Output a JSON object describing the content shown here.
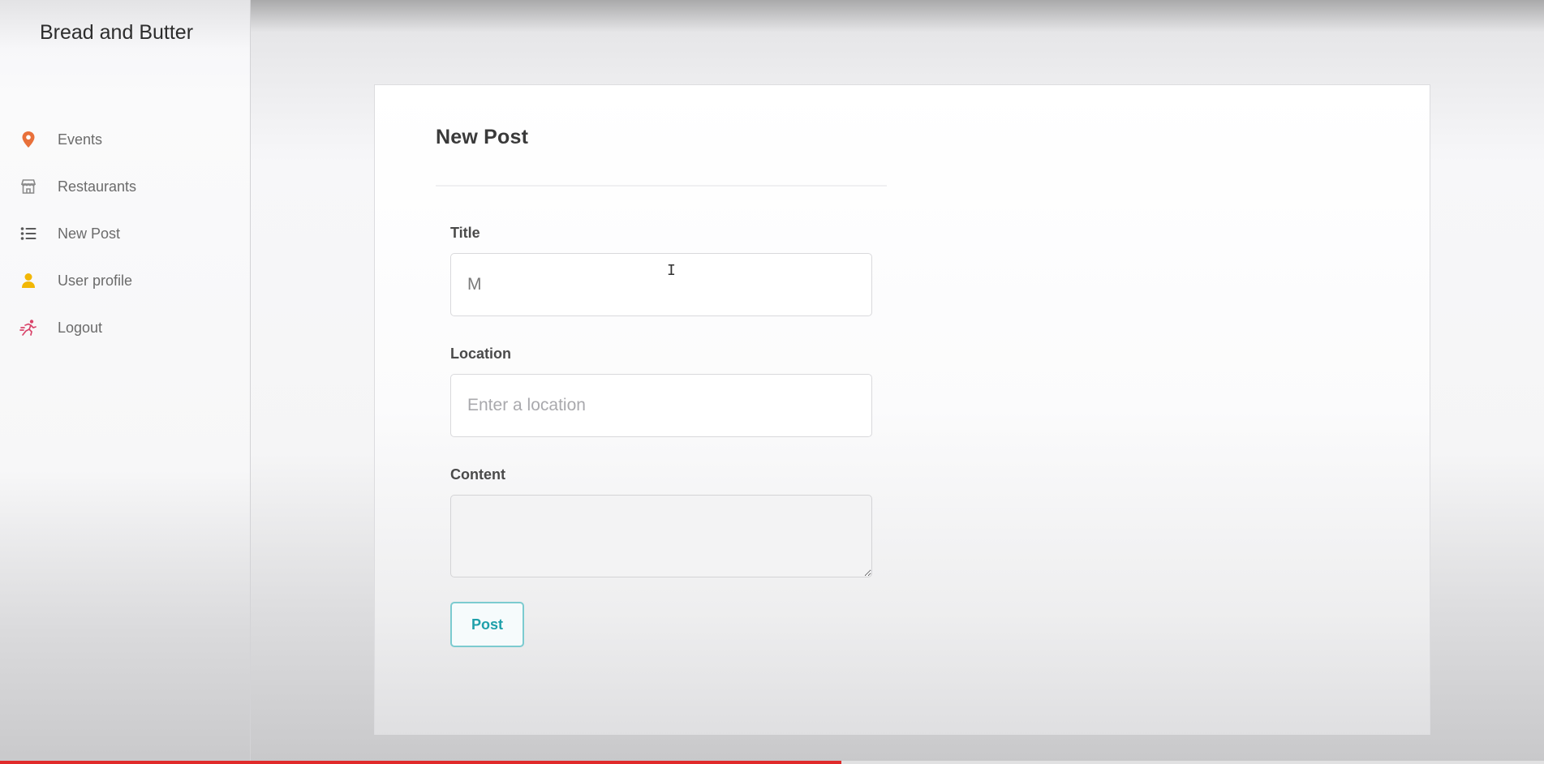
{
  "app": {
    "brand": "Bread and Butter"
  },
  "sidebar": {
    "items": [
      {
        "label": "Events",
        "icon": "map-pin-icon",
        "color": "#e8703a"
      },
      {
        "label": "Restaurants",
        "icon": "shop-icon",
        "color": "#8a8a8a"
      },
      {
        "label": "New Post",
        "icon": "list-icon",
        "color": "#5a5a5a"
      },
      {
        "label": "User profile",
        "icon": "user-icon",
        "color": "#f2b705"
      },
      {
        "label": "Logout",
        "icon": "running-icon",
        "color": "#d9446a"
      }
    ]
  },
  "form": {
    "title": "New Post",
    "fields": {
      "title": {
        "label": "Title",
        "value": "M"
      },
      "location": {
        "label": "Location",
        "placeholder": "Enter a location",
        "value": ""
      },
      "content": {
        "label": "Content",
        "value": ""
      }
    },
    "submit_label": "Post"
  },
  "video_progress": {
    "played_fraction": 0.545,
    "color": "#e02a2a"
  }
}
